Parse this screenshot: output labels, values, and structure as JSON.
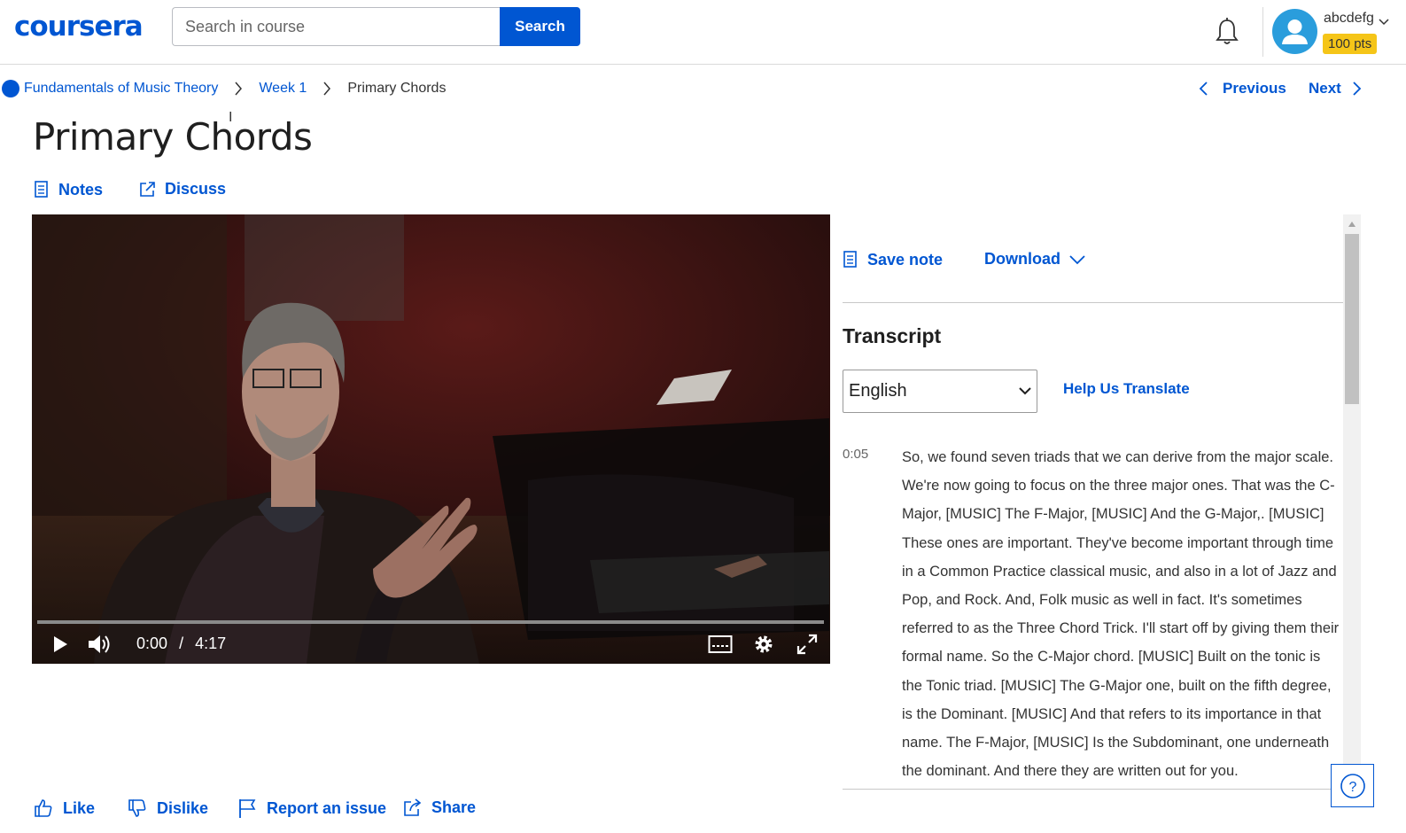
{
  "header": {
    "logo": "coursera",
    "search_placeholder": "Search in course",
    "search_button": "Search",
    "username": "abcdefg",
    "points": "100 pts"
  },
  "breadcrumb": {
    "course": "Fundamentals of Music Theory",
    "week": "Week 1",
    "current": "Primary Chords"
  },
  "nav": {
    "previous": "Previous",
    "next": "Next"
  },
  "page": {
    "title": "Primary Chords",
    "notes": "Notes",
    "discuss": "Discuss"
  },
  "video": {
    "current_time": "0:00",
    "separator": "/",
    "duration": "4:17",
    "progress": 0
  },
  "panel": {
    "save_note": "Save note",
    "download": "Download",
    "transcript_heading": "Transcript",
    "language": "English",
    "help_translate": "Help Us Translate",
    "transcript_time": "0:05",
    "transcript_text": "So, we found seven triads that we can derive from the major scale. We're now going to focus on the three major ones. That was the C-Major, [MUSIC] The F-Major, [MUSIC] And the G-Major,. [MUSIC] These ones are important. They've become important through time in a Common Practice classical music, and also in a lot of Jazz and Pop, and Rock. And, Folk music as well in fact. It's sometimes referred to as the Three Chord Trick. I'll start off by giving them their formal name. So the C-Major chord. [MUSIC] Built on the tonic is the Tonic triad. [MUSIC] The G-Major one, built on the fifth degree, is the Dominant. [MUSIC] And that refers to its importance in that name. The F-Major, [MUSIC] Is the Subdominant, one underneath the dominant. And there they are written out for you."
  },
  "reactions": {
    "like": "Like",
    "dislike": "Dislike",
    "report": "Report an issue",
    "share": "Share"
  },
  "colors": {
    "accent": "#0056d2",
    "badge": "#f5c518"
  }
}
